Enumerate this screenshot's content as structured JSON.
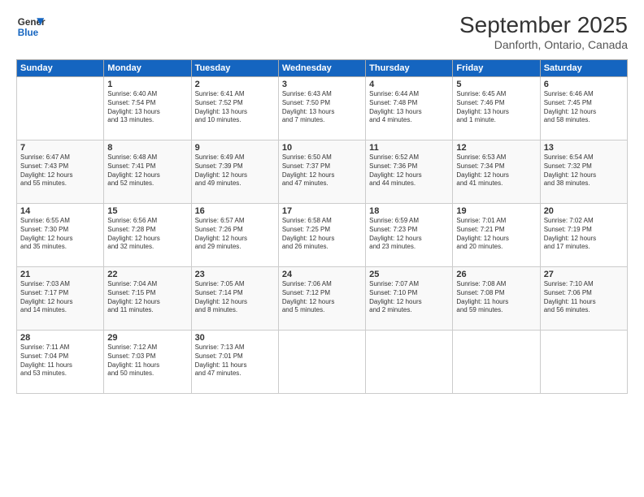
{
  "header": {
    "logo_line1": "General",
    "logo_line2": "Blue",
    "month": "September 2025",
    "location": "Danforth, Ontario, Canada"
  },
  "weekdays": [
    "Sunday",
    "Monday",
    "Tuesday",
    "Wednesday",
    "Thursday",
    "Friday",
    "Saturday"
  ],
  "weeks": [
    [
      {
        "day": "",
        "info": ""
      },
      {
        "day": "1",
        "info": "Sunrise: 6:40 AM\nSunset: 7:54 PM\nDaylight: 13 hours\nand 13 minutes."
      },
      {
        "day": "2",
        "info": "Sunrise: 6:41 AM\nSunset: 7:52 PM\nDaylight: 13 hours\nand 10 minutes."
      },
      {
        "day": "3",
        "info": "Sunrise: 6:43 AM\nSunset: 7:50 PM\nDaylight: 13 hours\nand 7 minutes."
      },
      {
        "day": "4",
        "info": "Sunrise: 6:44 AM\nSunset: 7:48 PM\nDaylight: 13 hours\nand 4 minutes."
      },
      {
        "day": "5",
        "info": "Sunrise: 6:45 AM\nSunset: 7:46 PM\nDaylight: 13 hours\nand 1 minute."
      },
      {
        "day": "6",
        "info": "Sunrise: 6:46 AM\nSunset: 7:45 PM\nDaylight: 12 hours\nand 58 minutes."
      }
    ],
    [
      {
        "day": "7",
        "info": "Sunrise: 6:47 AM\nSunset: 7:43 PM\nDaylight: 12 hours\nand 55 minutes."
      },
      {
        "day": "8",
        "info": "Sunrise: 6:48 AM\nSunset: 7:41 PM\nDaylight: 12 hours\nand 52 minutes."
      },
      {
        "day": "9",
        "info": "Sunrise: 6:49 AM\nSunset: 7:39 PM\nDaylight: 12 hours\nand 49 minutes."
      },
      {
        "day": "10",
        "info": "Sunrise: 6:50 AM\nSunset: 7:37 PM\nDaylight: 12 hours\nand 47 minutes."
      },
      {
        "day": "11",
        "info": "Sunrise: 6:52 AM\nSunset: 7:36 PM\nDaylight: 12 hours\nand 44 minutes."
      },
      {
        "day": "12",
        "info": "Sunrise: 6:53 AM\nSunset: 7:34 PM\nDaylight: 12 hours\nand 41 minutes."
      },
      {
        "day": "13",
        "info": "Sunrise: 6:54 AM\nSunset: 7:32 PM\nDaylight: 12 hours\nand 38 minutes."
      }
    ],
    [
      {
        "day": "14",
        "info": "Sunrise: 6:55 AM\nSunset: 7:30 PM\nDaylight: 12 hours\nand 35 minutes."
      },
      {
        "day": "15",
        "info": "Sunrise: 6:56 AM\nSunset: 7:28 PM\nDaylight: 12 hours\nand 32 minutes."
      },
      {
        "day": "16",
        "info": "Sunrise: 6:57 AM\nSunset: 7:26 PM\nDaylight: 12 hours\nand 29 minutes."
      },
      {
        "day": "17",
        "info": "Sunrise: 6:58 AM\nSunset: 7:25 PM\nDaylight: 12 hours\nand 26 minutes."
      },
      {
        "day": "18",
        "info": "Sunrise: 6:59 AM\nSunset: 7:23 PM\nDaylight: 12 hours\nand 23 minutes."
      },
      {
        "day": "19",
        "info": "Sunrise: 7:01 AM\nSunset: 7:21 PM\nDaylight: 12 hours\nand 20 minutes."
      },
      {
        "day": "20",
        "info": "Sunrise: 7:02 AM\nSunset: 7:19 PM\nDaylight: 12 hours\nand 17 minutes."
      }
    ],
    [
      {
        "day": "21",
        "info": "Sunrise: 7:03 AM\nSunset: 7:17 PM\nDaylight: 12 hours\nand 14 minutes."
      },
      {
        "day": "22",
        "info": "Sunrise: 7:04 AM\nSunset: 7:15 PM\nDaylight: 12 hours\nand 11 minutes."
      },
      {
        "day": "23",
        "info": "Sunrise: 7:05 AM\nSunset: 7:14 PM\nDaylight: 12 hours\nand 8 minutes."
      },
      {
        "day": "24",
        "info": "Sunrise: 7:06 AM\nSunset: 7:12 PM\nDaylight: 12 hours\nand 5 minutes."
      },
      {
        "day": "25",
        "info": "Sunrise: 7:07 AM\nSunset: 7:10 PM\nDaylight: 12 hours\nand 2 minutes."
      },
      {
        "day": "26",
        "info": "Sunrise: 7:08 AM\nSunset: 7:08 PM\nDaylight: 11 hours\nand 59 minutes."
      },
      {
        "day": "27",
        "info": "Sunrise: 7:10 AM\nSunset: 7:06 PM\nDaylight: 11 hours\nand 56 minutes."
      }
    ],
    [
      {
        "day": "28",
        "info": "Sunrise: 7:11 AM\nSunset: 7:04 PM\nDaylight: 11 hours\nand 53 minutes."
      },
      {
        "day": "29",
        "info": "Sunrise: 7:12 AM\nSunset: 7:03 PM\nDaylight: 11 hours\nand 50 minutes."
      },
      {
        "day": "30",
        "info": "Sunrise: 7:13 AM\nSunset: 7:01 PM\nDaylight: 11 hours\nand 47 minutes."
      },
      {
        "day": "",
        "info": ""
      },
      {
        "day": "",
        "info": ""
      },
      {
        "day": "",
        "info": ""
      },
      {
        "day": "",
        "info": ""
      }
    ]
  ]
}
